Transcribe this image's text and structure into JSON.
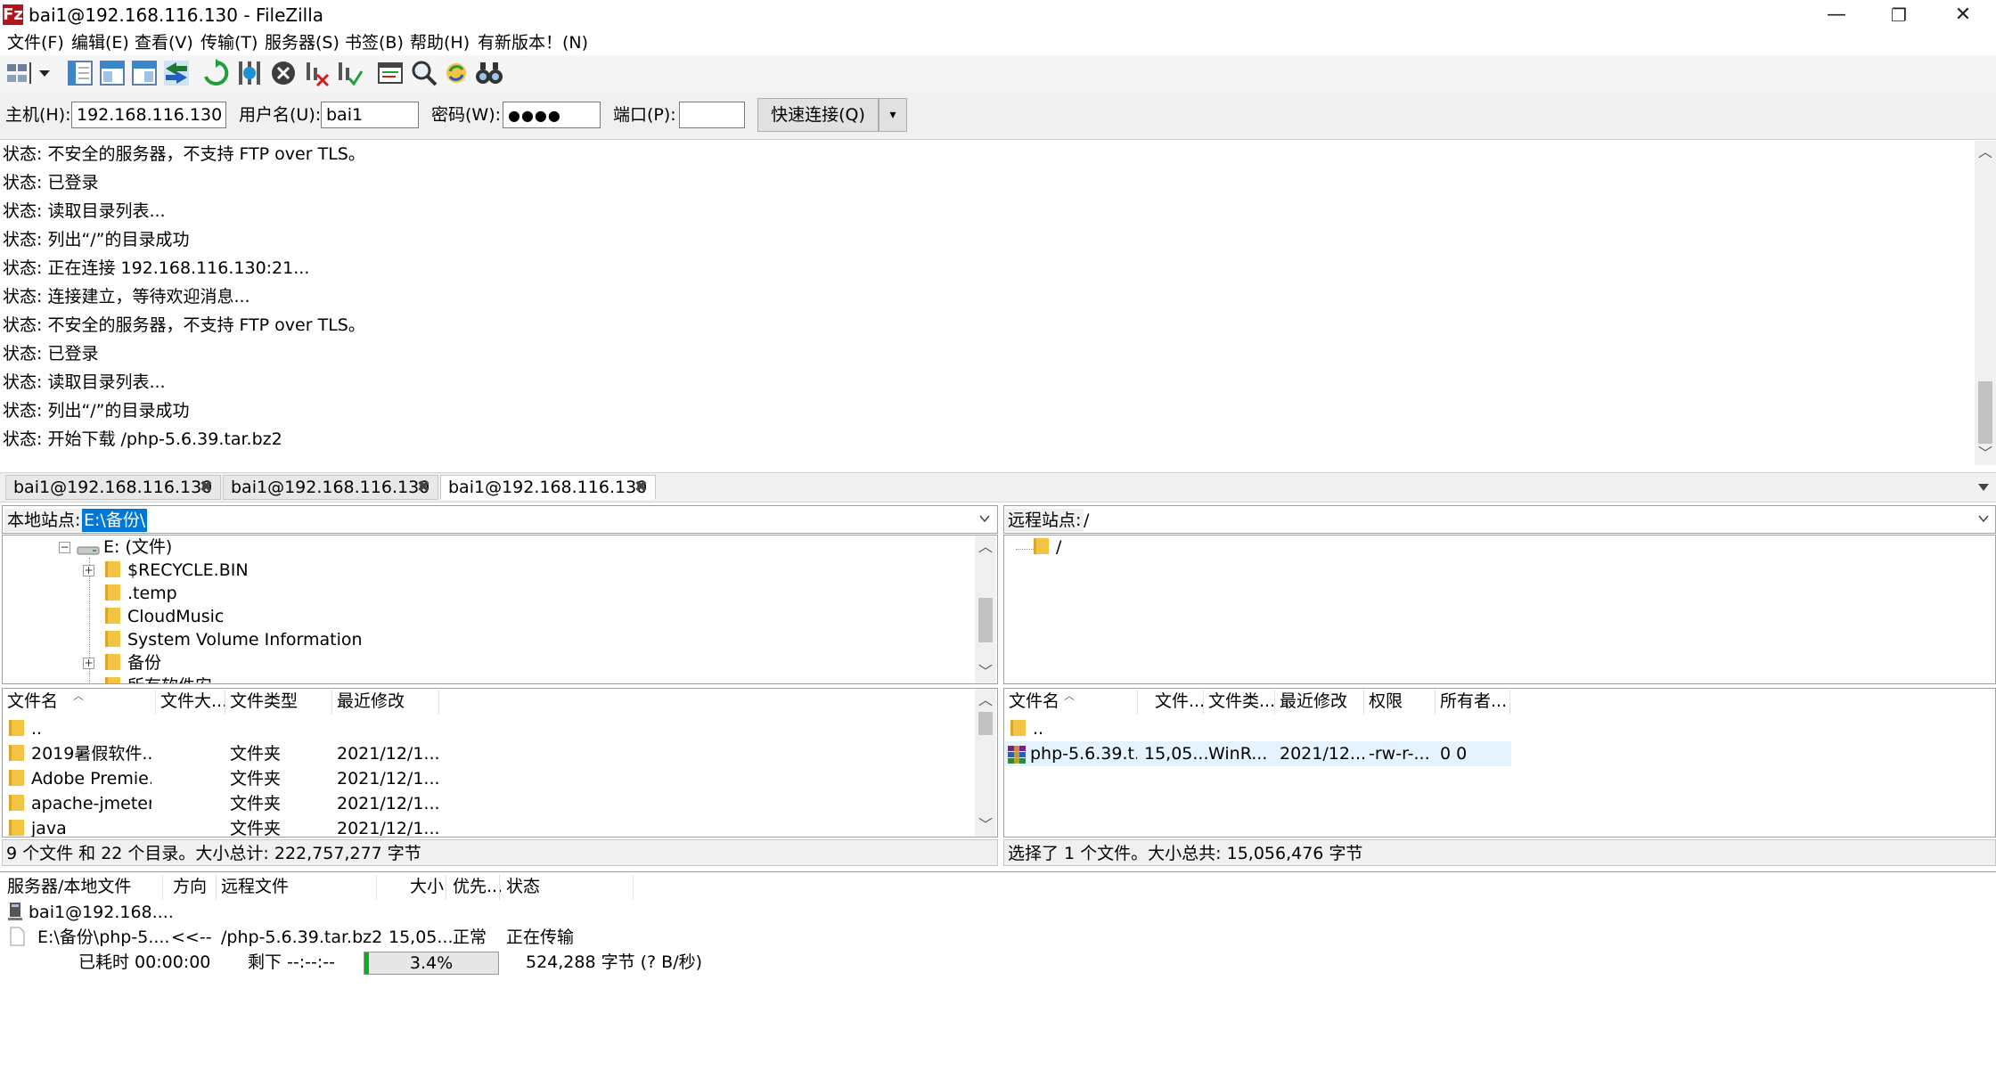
{
  "window": {
    "title": "bai1@192.168.116.130 - FileZilla",
    "app_icon": "Fz",
    "controls": {
      "minimize": "—",
      "restore": "❐",
      "close": "✕"
    }
  },
  "menu": [
    "文件(F)",
    "编辑(E)",
    "查看(V)",
    "传输(T)",
    "服务器(S)",
    "书签(B)",
    "帮助(H)",
    "有新版本！(N)"
  ],
  "toolbar": {
    "icons": [
      "site-manager-icon",
      "dropdown-arrow-icon",
      "toggle-log-icon",
      "toggle-local-tree-icon",
      "toggle-remote-tree-icon",
      "toggle-transfer-queue-icon",
      "refresh-icon",
      "process-queue-icon",
      "cancel-icon",
      "disconnect-icon",
      "reconnect-icon",
      "filter-icon",
      "compare-icon",
      "sync-browse-icon",
      "search-icon"
    ],
    "accent": "#1e90d6"
  },
  "quickconnect": {
    "host_label": "主机(H):",
    "host_value": "192.168.116.130",
    "user_label": "用户名(U):",
    "user_value": "bai1",
    "pass_label": "密码(W):",
    "pass_value": "●●●●",
    "port_label": "端口(P):",
    "port_value": "",
    "connect_label": "快速连接(Q)",
    "dropdown": "▾"
  },
  "log": [
    "状态: 不安全的服务器，不支持 FTP over TLS。",
    "状态: 已登录",
    "状态: 读取目录列表...",
    "状态: 列出“/”的目录成功",
    "状态: 正在连接 192.168.116.130:21...",
    "状态: 连接建立，等待欢迎消息...",
    "状态: 不安全的服务器，不支持 FTP over TLS。",
    "状态: 已登录",
    "状态: 读取目录列表...",
    "状态: 列出“/”的目录成功",
    "状态: 开始下载 /php-5.6.39.tar.bz2"
  ],
  "tabs": [
    {
      "label": "bai1@192.168.116.130",
      "close": "✖"
    },
    {
      "label": "bai1@192.168.116.130",
      "close": "✖"
    },
    {
      "label": "bai1@192.168.116.130",
      "close": "✖"
    }
  ],
  "local": {
    "site_label": "本地站点:",
    "path": "E:\\备份\\",
    "tree": {
      "drive": "E: (文件)",
      "items": [
        "$RECYCLE.BIN",
        ".temp",
        "CloudMusic",
        "System Volume Information",
        "备份"
      ],
      "cut_item": "所有软件安..."
    },
    "columns": [
      "文件名",
      "文件大...",
      "文件类型",
      "最近修改"
    ],
    "files": [
      {
        "name": "..",
        "size": "",
        "type": "",
        "modified": ""
      },
      {
        "name": "2019暑假软件...",
        "size": "",
        "type": "文件夹",
        "modified": "2021/12/1..."
      },
      {
        "name": "Adobe Premie...",
        "size": "",
        "type": "文件夹",
        "modified": "2021/12/1..."
      },
      {
        "name": "apache-jmeter...",
        "size": "",
        "type": "文件夹",
        "modified": "2021/12/1..."
      },
      {
        "name": "java",
        "size": "",
        "type": "文件夹",
        "modified": "2021/12/1..."
      }
    ],
    "status": "9 个文件 和 22 个目录。大小总计: 222,757,277 字节"
  },
  "remote": {
    "site_label": "远程站点:",
    "path": "/",
    "tree": {
      "root": "/"
    },
    "columns": [
      "文件名",
      "文件...",
      "文件类...",
      "最近修改",
      "权限",
      "所有者..."
    ],
    "files": [
      {
        "name": "..",
        "size": "",
        "type": "",
        "modified": "",
        "perms": "",
        "owner": ""
      },
      {
        "name": "php-5.6.39.t...",
        "size": "15,05...",
        "type": "WinR...",
        "modified": "2021/12...",
        "perms": "-rw-r-...",
        "owner": "0 0"
      }
    ],
    "status": "选择了 1 个文件。大小总共: 15,056,476 字节"
  },
  "queue": {
    "columns": [
      "服务器/本地文件",
      "方向",
      "远程文件",
      "大小",
      "优先...",
      "状态"
    ],
    "server": "bai1@192.168....",
    "transfer": {
      "local": "E:\\备份\\php-5....",
      "direction": "<<--",
      "remote": "/php-5.6.39.tar.bz2",
      "size": "15,05...",
      "priority": "正常",
      "status": "正在传输"
    },
    "elapsed": "已耗时 00:00:00",
    "remaining": "剩下 --:--:--",
    "progress_text": "3.4%",
    "progress_fraction": 0.034,
    "bytes": "524,288 字节 (? B/秒)"
  }
}
